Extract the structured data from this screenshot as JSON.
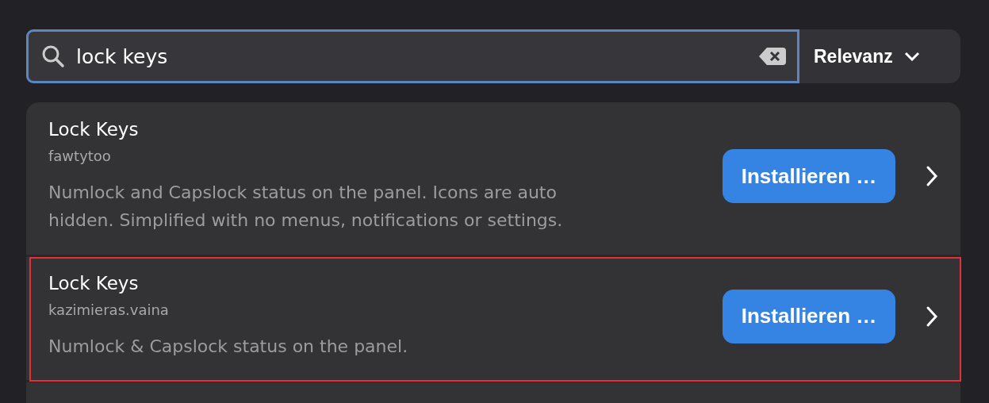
{
  "search": {
    "value": "lock keys"
  },
  "sort": {
    "label": "Relevanz"
  },
  "results": [
    {
      "title": "Lock Keys",
      "author": "fawtytoo",
      "description": "Numlock and Capslock status on the panel. Icons are auto hidden. Simplified with no menus, notifications or settings.",
      "button": "Installieren …",
      "highlighted": false
    },
    {
      "title": "Lock Keys",
      "author": "kazimieras.vaina",
      "description": "Numlock & Capslock status on the panel.",
      "button": "Installieren …",
      "highlighted": true
    }
  ]
}
